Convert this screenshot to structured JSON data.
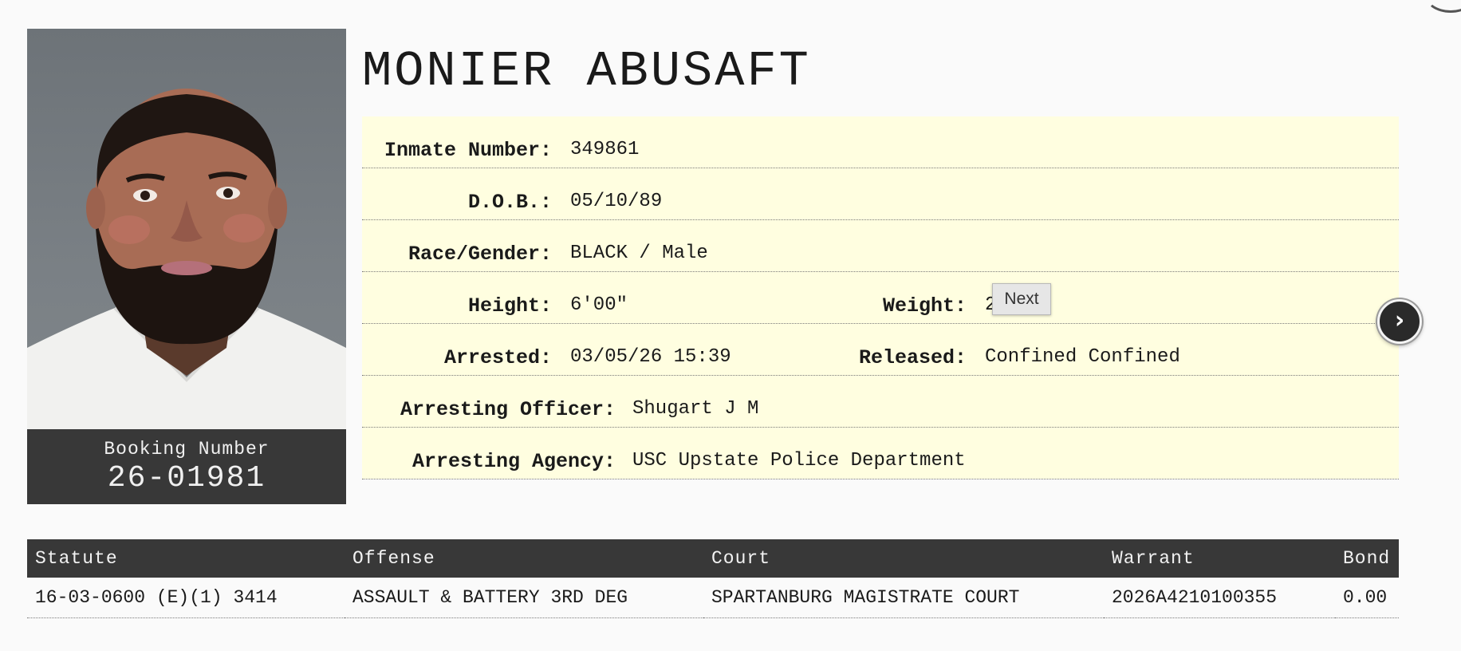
{
  "inmate": {
    "name": "MONIER ABUSAFT",
    "booking_label": "Booking Number",
    "booking_number": "26-01981"
  },
  "details": {
    "inmate_number_label": "Inmate Number:",
    "inmate_number": "349861",
    "dob_label": "D.O.B.:",
    "dob": "05/10/89",
    "race_gender_label": "Race/Gender:",
    "race_gender": "BLACK / Male",
    "height_label": "Height:",
    "height": "6'00\"",
    "weight_label": "Weight:",
    "weight": "2",
    "arrested_label": "Arrested:",
    "arrested": "03/05/26 15:39",
    "released_label": "Released:",
    "released": "Confined Confined",
    "officer_label": "Arresting Officer:",
    "officer": "Shugart J M",
    "agency_label": "Arresting Agency:",
    "agency": "USC Upstate Police Department"
  },
  "tooltip": {
    "text": "Next"
  },
  "nav": {
    "next_icon": "chevron-right-icon",
    "next_glyph": "›"
  },
  "charges": {
    "headers": [
      "Statute",
      "Offense",
      "Court",
      "Warrant",
      "Bond"
    ],
    "rows": [
      [
        "16-03-0600 (E)(1) 3414",
        "ASSAULT & BATTERY 3RD DEG",
        "SPARTANBURG MAGISTRATE COURT",
        "2026A4210100355",
        "0.00"
      ]
    ]
  }
}
